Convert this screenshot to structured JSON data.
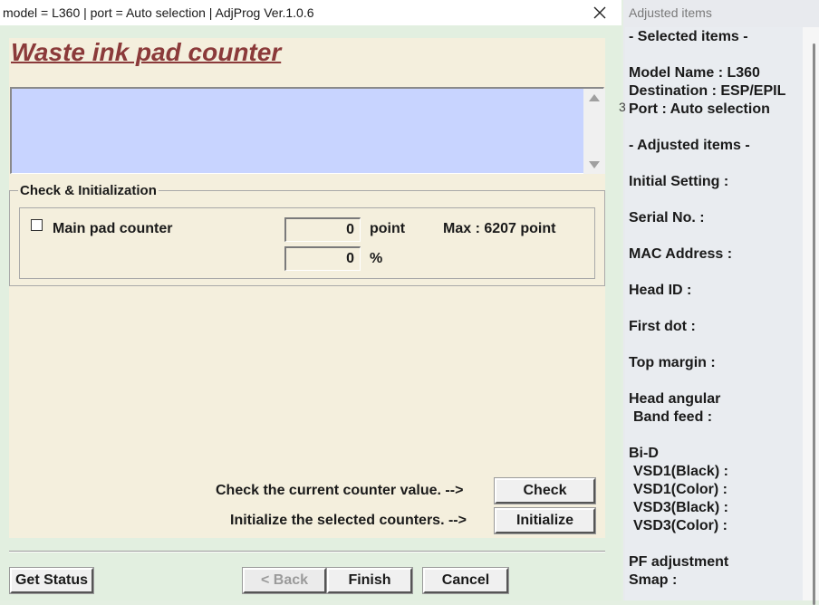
{
  "main_window": {
    "title": "model = L360 | port = Auto selection | AdjProg Ver.1.0.6",
    "heading": "Waste ink pad counter",
    "group_title": "Check & Initialization",
    "counter": {
      "label": "Main pad counter",
      "checked": false,
      "point_value": "0",
      "point_unit": "point",
      "max_text": "Max : 6207 point",
      "percent_value": "0",
      "percent_unit": "%"
    },
    "check_hint": "Check the current counter value. -->",
    "check_button": "Check",
    "init_hint": "Initialize the selected counters. -->",
    "init_button": "Initialize",
    "buttons": {
      "get_status": "Get Status",
      "back": "< Back",
      "finish": "Finish",
      "cancel": "Cancel"
    },
    "close_icon": "close-icon"
  },
  "right_window": {
    "title": "Adjusted items",
    "stray_char": "3",
    "lines": [
      "- Selected items -",
      "Model Name : L360",
      "Destination : ESP/EPIL",
      "Port : Auto selection",
      "- Adjusted items -",
      "Initial Setting :",
      "Serial No. :",
      "MAC Address :",
      "Head ID :",
      "First dot :",
      "Top margin :",
      "Head angular",
      "Band feed :",
      "Bi-D",
      "VSD1(Black) :",
      "VSD1(Color) :",
      "VSD3(Black) :",
      "VSD3(Color) :",
      "PF adjustment",
      "Smap :"
    ]
  },
  "colors": {
    "heading": "#8b3a3a",
    "message_area": "#c8d4ff",
    "panel": "#f4efdd",
    "window_bg": "#e2efe0"
  }
}
